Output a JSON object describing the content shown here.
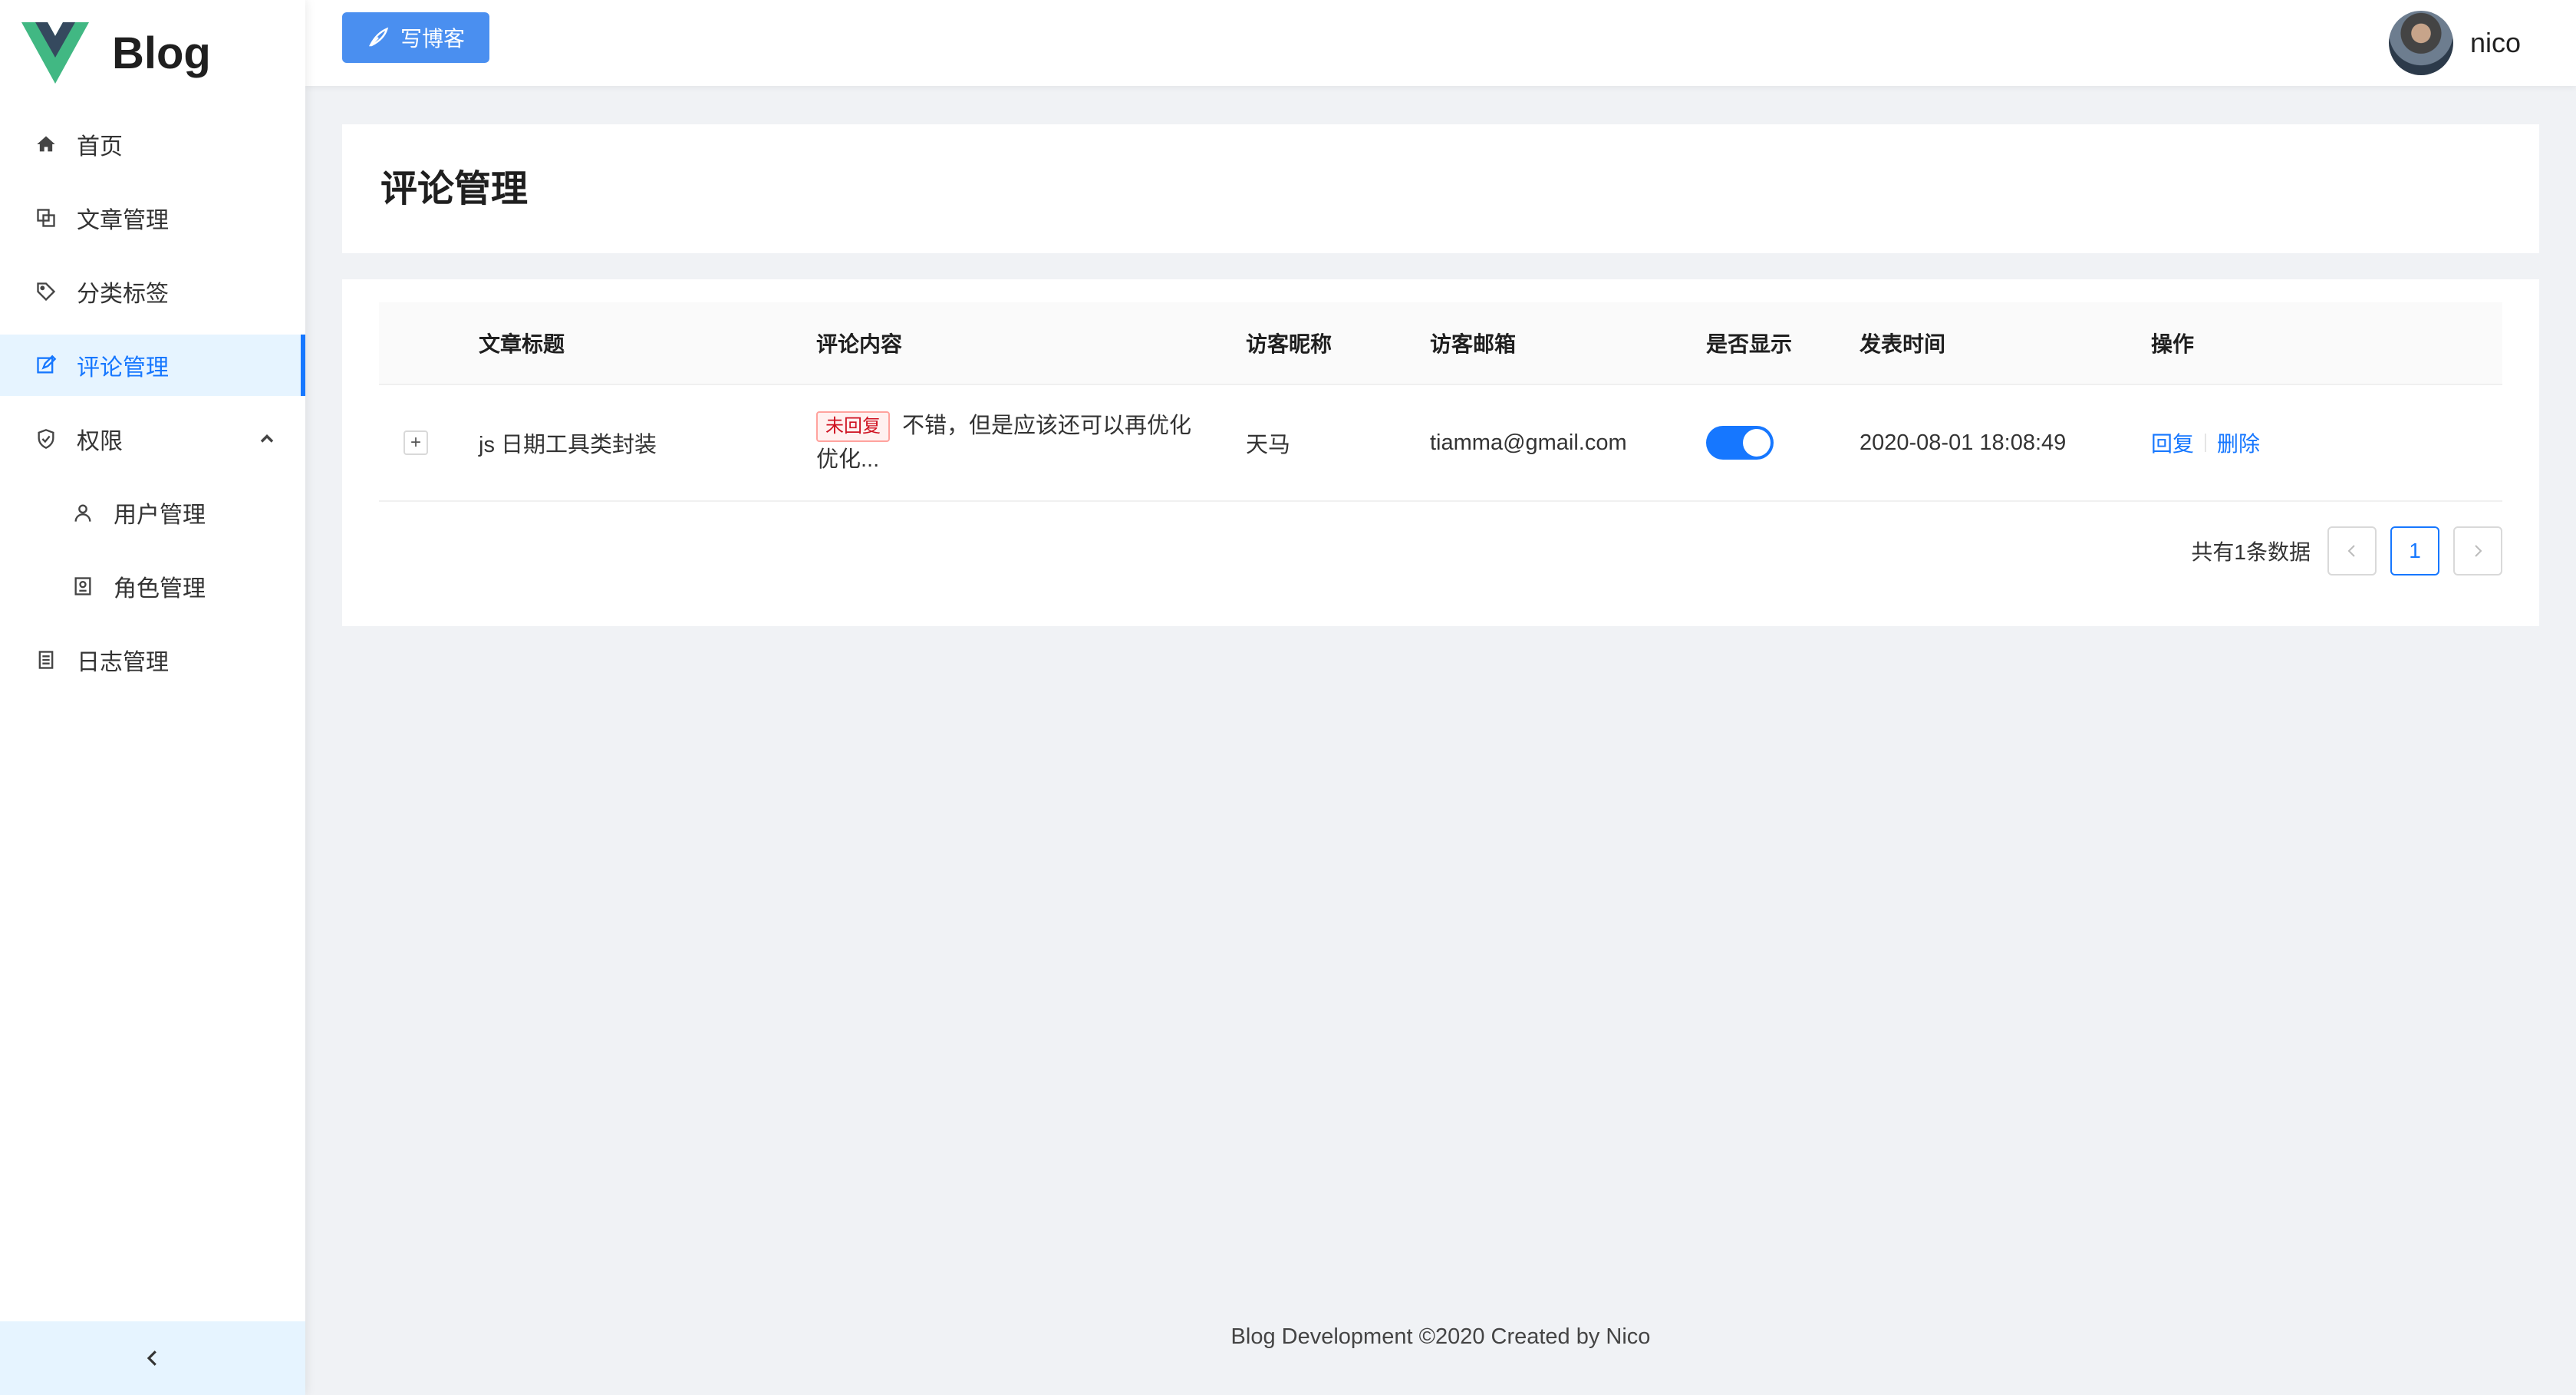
{
  "app": {
    "logo_text": "Blog"
  },
  "sidebar": {
    "items": [
      {
        "label": "首页",
        "icon": "home-icon"
      },
      {
        "label": "文章管理",
        "icon": "copy-icon"
      },
      {
        "label": "分类标签",
        "icon": "tag-icon"
      },
      {
        "label": "评论管理",
        "icon": "edit-icon",
        "active": true
      },
      {
        "label": "权限",
        "icon": "safety-icon",
        "expanded": true
      },
      {
        "label": "用户管理",
        "icon": "user-icon",
        "sub": true
      },
      {
        "label": "角色管理",
        "icon": "id-card-icon",
        "sub": true
      },
      {
        "label": "日志管理",
        "icon": "file-text-icon"
      }
    ],
    "collapse_icon": "chevron-left-icon"
  },
  "header": {
    "write_button": "写博客",
    "user_name": "nico"
  },
  "page": {
    "title": "评论管理"
  },
  "table": {
    "columns": [
      "文章标题",
      "评论内容",
      "访客昵称",
      "访客邮箱",
      "是否显示",
      "发表时间",
      "操作"
    ],
    "rows": [
      {
        "expand": "+",
        "title": "js 日期工具类封装",
        "tag": "未回复",
        "content_line1": "不错，但是应该还可以再优化",
        "content_line2": "优化...",
        "nickname": "天马",
        "email": "tiamma@gmail.com",
        "visible": true,
        "time": "2020-08-01 18:08:49",
        "action_reply": "回复",
        "action_delete": "删除"
      }
    ]
  },
  "pagination": {
    "total_text": "共有1条数据",
    "current_page": "1",
    "prev_icon": "chevron-left-icon",
    "next_icon": "chevron-right-icon"
  },
  "footer": {
    "text": "Blog Development ©2020 Created by Nico"
  },
  "colors": {
    "primary": "#1677ff",
    "sidebar_active_bg": "#e6f4ff",
    "tag_red": "#cf1322"
  }
}
